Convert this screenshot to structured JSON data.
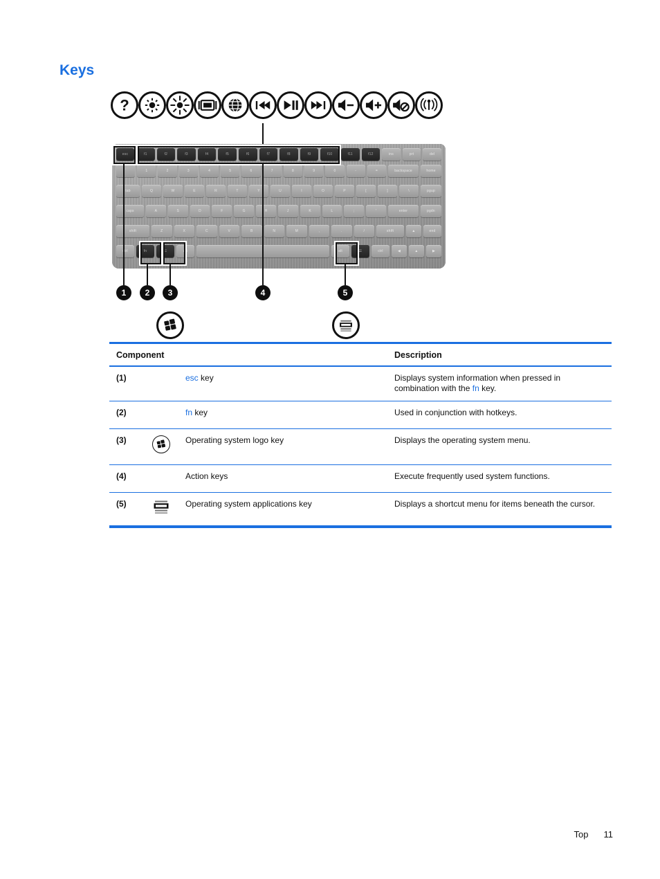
{
  "document": {
    "title": "Keys",
    "accent_color": "#1a6fe0",
    "text_color": "#111111"
  },
  "figure": {
    "alt": "Laptop keyboard with callouts",
    "action_key_icons": [
      {
        "name": "help-question-icon",
        "label": "?"
      },
      {
        "name": "brightness-down-icon",
        "label": "brightness down"
      },
      {
        "name": "brightness-up-icon",
        "label": "brightness up"
      },
      {
        "name": "display-switch-icon",
        "label": "switch screen image"
      },
      {
        "name": "web-browser-globe-icon",
        "label": "web browser"
      },
      {
        "name": "previous-track-icon",
        "label": "previous track"
      },
      {
        "name": "play-pause-icon",
        "label": "play/pause"
      },
      {
        "name": "next-track-icon",
        "label": "next track"
      },
      {
        "name": "volume-down-icon",
        "label": "volume down"
      },
      {
        "name": "volume-up-icon",
        "label": "volume up"
      },
      {
        "name": "mute-icon",
        "label": "mute"
      },
      {
        "name": "wireless-icon",
        "label": "wireless"
      }
    ],
    "callouts": [
      {
        "number": "1"
      },
      {
        "number": "2"
      },
      {
        "number": "3"
      },
      {
        "number": "4"
      },
      {
        "number": "5"
      }
    ],
    "legend_icons": [
      {
        "name": "windows-logo-icon",
        "for_callout": "3"
      },
      {
        "name": "applications-key-icon",
        "for_callout": "5"
      }
    ],
    "keyboard_rows": {
      "fn_row": [
        "esc",
        "f1",
        "f2",
        "f3",
        "f4",
        "f5",
        "f6",
        "f7",
        "f8",
        "f9",
        "f10",
        "f11",
        "f12",
        "ins",
        "prt",
        "del"
      ],
      "num_row": [
        "`",
        "1",
        "2",
        "3",
        "4",
        "5",
        "6",
        "7",
        "8",
        "9",
        "0",
        "-",
        "=",
        "backspace",
        "home"
      ],
      "top_row": [
        "tab",
        "Q",
        "W",
        "E",
        "R",
        "T",
        "Y",
        "U",
        "I",
        "O",
        "P",
        "[",
        "]",
        "\\",
        "pgup"
      ],
      "home_row": [
        "caps",
        "A",
        "S",
        "D",
        "F",
        "G",
        "H",
        "J",
        "K",
        "L",
        ";",
        "'",
        "enter",
        "pgdn"
      ],
      "bottom_row": [
        "shift",
        "Z",
        "X",
        "C",
        "V",
        "B",
        "N",
        "M",
        ",",
        ".",
        "/",
        "shift",
        "up",
        "end"
      ],
      "space_row": [
        "ctrl",
        "fn",
        "win",
        "alt",
        "space",
        "alt",
        "menu",
        "ctrl",
        "left",
        "up/dn",
        "right"
      ]
    }
  },
  "table": {
    "headers": {
      "component": "Component",
      "description": "Description"
    },
    "rows": [
      {
        "number": "(1)",
        "icon": "",
        "name_prefix": "esc",
        "name_suffix": " key",
        "desc_part1": "Displays system information when pressed in combination with the ",
        "desc_key": "fn",
        "desc_part2": " key."
      },
      {
        "number": "(2)",
        "icon": "",
        "name_prefix": "fn",
        "name_suffix": " key",
        "desc_part1": "Used in conjunction with hotkeys.",
        "desc_key": "",
        "desc_part2": ""
      },
      {
        "number": "(3)",
        "icon": "windows-logo-icon",
        "name_prefix": "",
        "name_suffix": "Operating system logo key",
        "desc_part1": "Displays the operating system menu.",
        "desc_key": "",
        "desc_part2": ""
      },
      {
        "number": "(4)",
        "icon": "",
        "name_prefix": "",
        "name_suffix": "Action keys",
        "desc_part1": "Execute frequently used system functions.",
        "desc_key": "",
        "desc_part2": ""
      },
      {
        "number": "(5)",
        "icon": "applications-key-icon",
        "name_prefix": "",
        "name_suffix": "Operating system applications key",
        "desc_part1": "Displays a shortcut menu for items beneath the cursor.",
        "desc_key": "",
        "desc_part2": ""
      }
    ]
  },
  "footer": {
    "section": "Top",
    "page_number": "11"
  }
}
